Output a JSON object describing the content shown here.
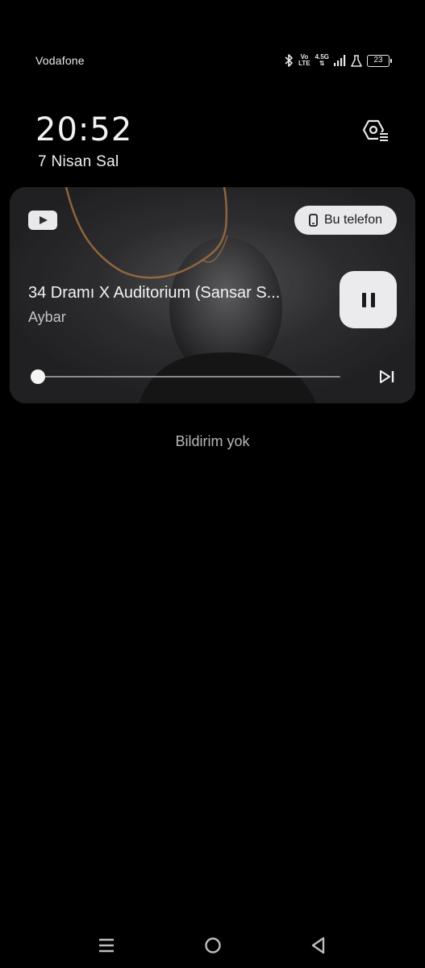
{
  "status_bar": {
    "carrier": "Vodafone",
    "volte_top": "Vo",
    "volte_bottom": "LTE",
    "network_type": "4.5G",
    "network_arrows": "⇅",
    "battery_level": "23",
    "icons": [
      "bluetooth-icon",
      "volte-icon",
      "network-4.5g-icon",
      "signal-icon",
      "lab-flask-icon",
      "battery-icon"
    ]
  },
  "lockscreen": {
    "time": "20:52",
    "date": "7 Nisan Sal"
  },
  "media": {
    "source_app_icon": "youtube-icon",
    "output_device_label": "Bu telefon",
    "title": "34 Dramı X Auditorium (Sansar S...",
    "artist": "Aybar",
    "playback_state": "playing",
    "progress": 0.02
  },
  "notifications": {
    "empty_message": "Bildirim yok"
  },
  "nav": {
    "items": [
      "menu-icon",
      "home-icon",
      "back-icon"
    ]
  },
  "colors": {
    "background": "#000000",
    "card": "#2b2b2e",
    "pill": "#e9e9ec",
    "muted_text": "#b7b7b7"
  }
}
